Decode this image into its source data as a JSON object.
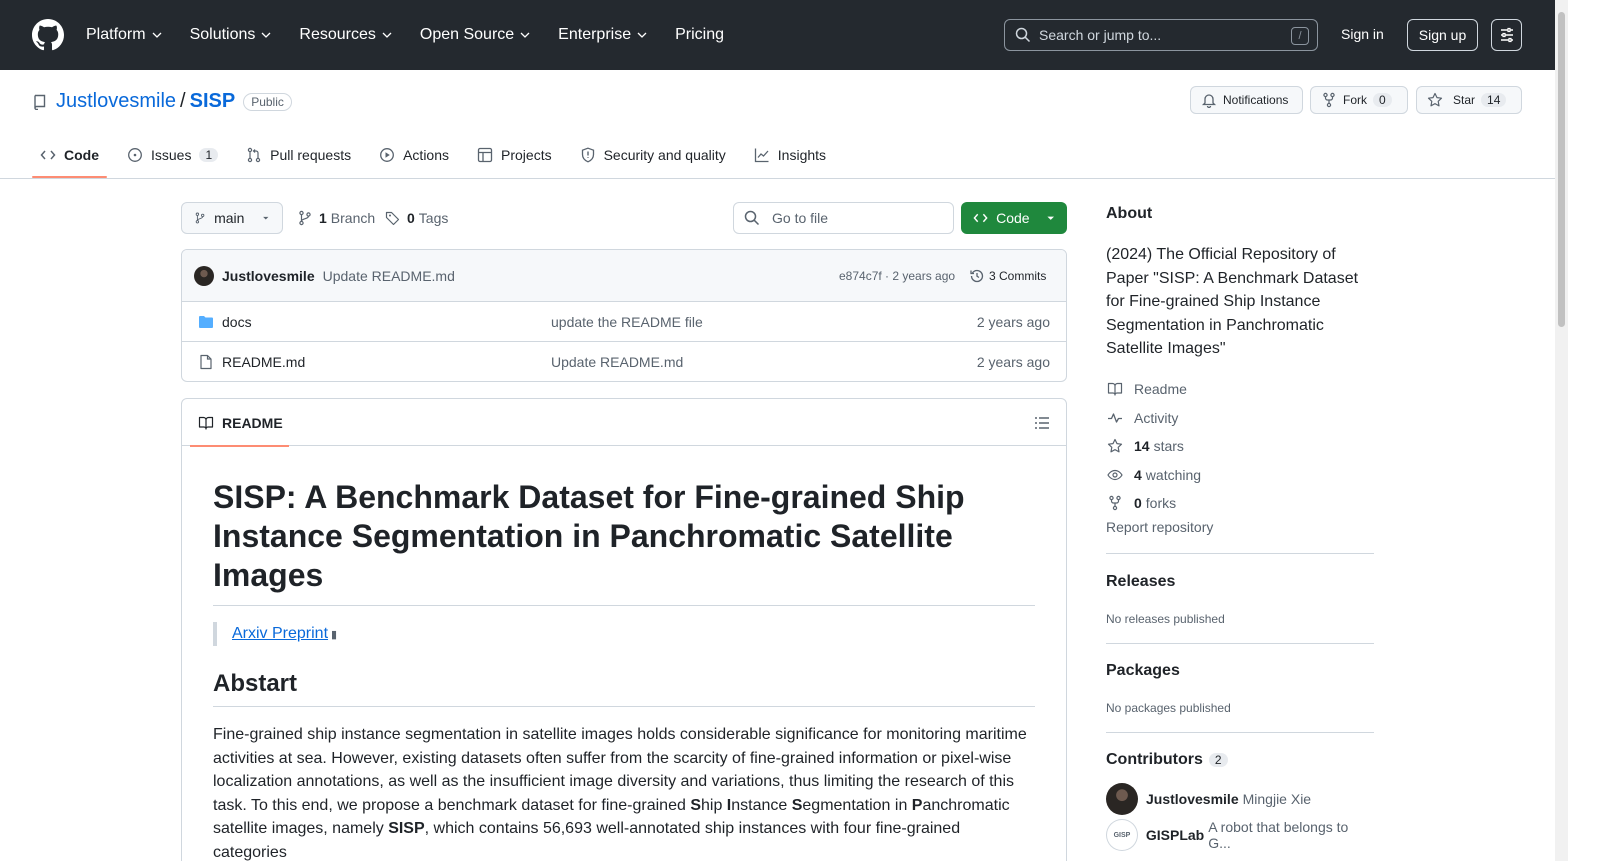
{
  "header": {
    "nav": [
      "Platform",
      "Solutions",
      "Resources",
      "Open Source",
      "Enterprise",
      "Pricing"
    ],
    "search_placeholder": "Search or jump to...",
    "search_hint": "/",
    "signin": "Sign in",
    "signup": "Sign up"
  },
  "repo": {
    "owner": "Justlovesmile",
    "sep": "/",
    "name": "SISP",
    "visibility": "Public",
    "notifications": "Notifications",
    "fork_label": "Fork",
    "fork_count": "0",
    "star_label": "Star",
    "star_count": "14"
  },
  "tabs": [
    {
      "label": "Code"
    },
    {
      "label": "Issues",
      "count": "1"
    },
    {
      "label": "Pull requests"
    },
    {
      "label": "Actions"
    },
    {
      "label": "Projects"
    },
    {
      "label": "Security and quality"
    },
    {
      "label": "Insights"
    }
  ],
  "toolbar": {
    "branch": "main",
    "branches_count": "1",
    "branches_label": "Branch",
    "tags_count": "0",
    "tags_label": "Tags",
    "goto_placeholder": "Go to file",
    "code_label": "Code"
  },
  "commit": {
    "author": "Justlovesmile",
    "message": "Update README.md",
    "sha_time": "e874c7f · 2 years ago",
    "commits_label": "3 Commits"
  },
  "files": [
    {
      "name": "docs",
      "message": "update the README file",
      "date": "2 years ago",
      "type": "folder"
    },
    {
      "name": "README.md",
      "message": "Update README.md",
      "date": "2 years ago",
      "type": "file"
    }
  ],
  "readme": {
    "tab": "README",
    "title": "SISP: A Benchmark Dataset for Fine-grained Ship Instance Segmentation in Panchromatic Satellite Images",
    "preprint_link": "Arxiv Preprint",
    "abstract_heading": "Abstart",
    "abstract_parts": {
      "p1": "Fine-grained ship instance segmentation in satellite images holds considerable significance for monitoring maritime activities at sea. However, existing datasets often suffer from the scarcity of fine-grained information or pixel-wise localization annotations, as well as the insufficient image diversity and variations, thus limiting the research of this task. To this end, we propose a benchmark dataset for fine-grained ",
      "S1": "S",
      "p2": "hip ",
      "I": "I",
      "p3": "nstance ",
      "S2": "S",
      "p4": "egmentation in ",
      "P": "P",
      "p5": "anchromatic satellite images, namely ",
      "SISP": "SISP",
      "p6": ", which contains 56,693 well-annotated ship instances with four fine-grained categories"
    }
  },
  "sidebar": {
    "about_heading": "About",
    "description": "(2024) The Official Repository of Paper \"SISP: A Benchmark Dataset for Fine-grained Ship Instance Segmentation in Panchromatic Satellite Images\"",
    "links": {
      "readme": "Readme",
      "activity": "Activity",
      "stars_count": "14",
      "stars_label": "stars",
      "watching_count": "4",
      "watching_label": "watching",
      "forks_count": "0",
      "forks_label": "forks"
    },
    "report": "Report repository",
    "releases_heading": "Releases",
    "releases_sub": "No releases published",
    "packages_heading": "Packages",
    "packages_sub": "No packages published",
    "contributors_heading": "Contributors",
    "contributors_count": "2",
    "contributors": [
      {
        "login": "Justlovesmile",
        "name": "Mingjie Xie"
      },
      {
        "login": "GISPLab",
        "name": "A robot that belongs to G..."
      }
    ],
    "gisp_avatar_text": "GISP"
  }
}
